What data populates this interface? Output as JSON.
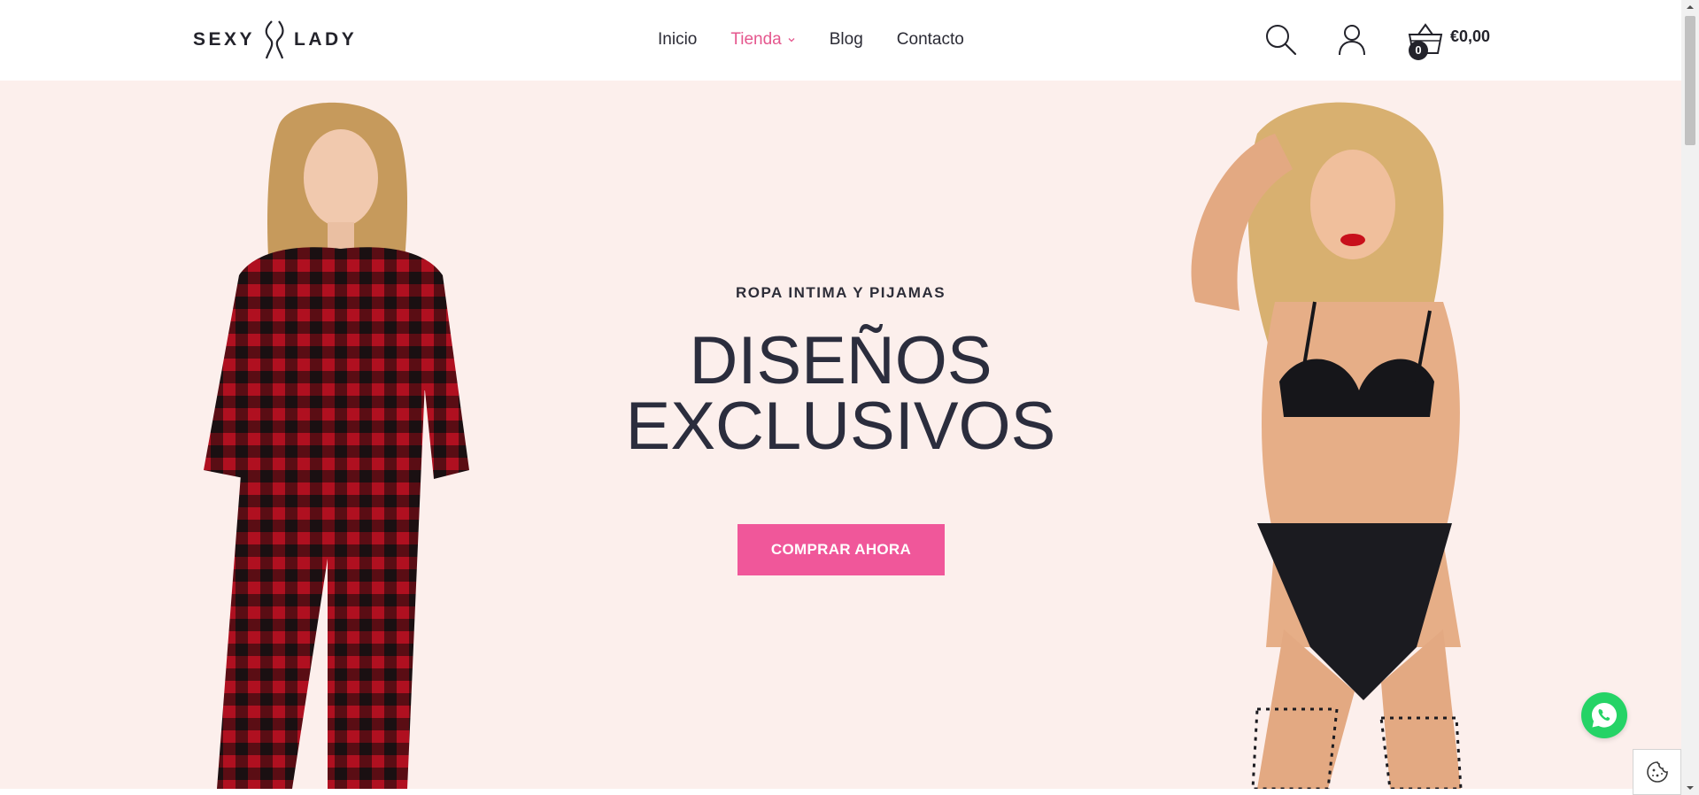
{
  "header": {
    "logo": {
      "word_left": "SEXY",
      "word_right": "LADY"
    },
    "nav": [
      {
        "label": "Inicio",
        "active": false
      },
      {
        "label": "Tienda",
        "active": true,
        "has_dropdown": true
      },
      {
        "label": "Blog",
        "active": false
      },
      {
        "label": "Contacto",
        "active": false
      }
    ],
    "icons": {
      "search": "search-icon",
      "account": "user-icon",
      "cart": "basket-icon"
    },
    "cart": {
      "count": "0",
      "total": "€0,00"
    }
  },
  "hero": {
    "eyebrow": "ROPA INTIMA Y PIJAMAS",
    "headline_line1": "DISEÑOS",
    "headline_line2": "EXCLUSIVOS",
    "cta_label": "COMPRAR AHORA",
    "left_image": "model-red-plaid-pajamas",
    "right_image": "model-black-lace-lingerie"
  },
  "floating": {
    "whatsapp": "whatsapp-icon",
    "cookie": "cookie-icon"
  },
  "colors": {
    "accent": "#e5578e",
    "cta": "#f0579a",
    "hero_bg": "#fcefec",
    "text_dark": "#2b2d3d",
    "whatsapp": "#25d366"
  }
}
